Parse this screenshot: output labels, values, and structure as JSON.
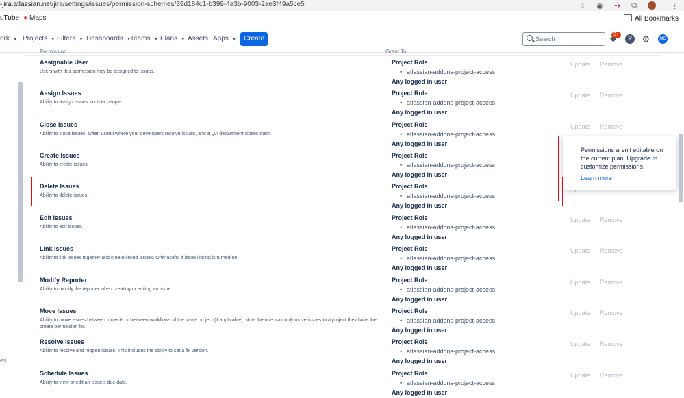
{
  "browser": {
    "url_host": "-jira.atlassian.net",
    "url_path": "/jira/settings/issues/permission-schemes/39d184c1-b399-4a3b-9003-2ae3f49a5ce5",
    "bookmarks": [
      {
        "label": "uTube"
      },
      {
        "label": "Maps"
      }
    ],
    "all_bookmarks": "All Bookmarks"
  },
  "nav": {
    "items": [
      "ork",
      "Projects",
      "Filters",
      "Dashboards",
      "Teams",
      "Plans",
      "Assets",
      "Apps"
    ],
    "create_label": "Create",
    "search_placeholder": "Search",
    "notifications_badge": "9+",
    "help_glyph": "?",
    "gear_glyph": "⚙",
    "avatar_initials": "MC"
  },
  "table": {
    "col_permission": "Permission",
    "col_grant": "Grant To",
    "action_update": "Update",
    "action_remove": "Remove",
    "rows": [
      {
        "name": "Assignable User",
        "desc": "Users with this permission may be assigned to issues.",
        "role": "Project Role",
        "item": "atlassian-addons-project-access",
        "any": "Any logged in user"
      },
      {
        "name": "Assign Issues",
        "desc": "Ability to assign issues to other people.",
        "role": "Project Role",
        "item": "atlassian-addons-project-access",
        "any": "Any logged in user"
      },
      {
        "name": "Close Issues",
        "desc": "Ability to close issues. Often useful where your developers resolve issues, and a QA department closes them.",
        "role": "Project Role",
        "item": "atlassian-addons-project-access",
        "any": "Any logged in user"
      },
      {
        "name": "Create Issues",
        "desc": "Ability to create issues.",
        "role": "Project Role",
        "item": "atlassian-addons-project-access",
        "any": "Any logged in user"
      },
      {
        "name": "Delete Issues",
        "desc": "Ability to delete issues.",
        "role": "Project Role",
        "item": "atlassian-addons-project-access",
        "any": "Any logged in user"
      },
      {
        "name": "Edit Issues",
        "desc": "Ability to edit issues.",
        "role": "Project Role",
        "item": "atlassian-addons-project-access",
        "any": "Any logged in user"
      },
      {
        "name": "Link Issues",
        "desc": "Ability to link issues together and create linked issues. Only useful if issue linking is turned on.",
        "role": "Project Role",
        "item": "atlassian-addons-project-access",
        "any": "Any logged in user"
      },
      {
        "name": "Modify Reporter",
        "desc": "Ability to modify the reporter when creating or editing an issue.",
        "role": "Project Role",
        "item": "atlassian-addons-project-access",
        "any": "Any logged in user"
      },
      {
        "name": "Move Issues",
        "desc": "Ability to move issues between projects or between workflows of the same project (if applicable). Note the user can only move issues to a project they have the create permission for.",
        "role": "Project Role",
        "item": "atlassian-addons-project-access",
        "any": "Any logged in user"
      },
      {
        "name": "Resolve Issues",
        "desc": "Ability to resolve and reopen issues. This includes the ability to set a fix version.",
        "role": "Project Role",
        "item": "atlassian-addons-project-access",
        "any": "Any logged in user"
      },
      {
        "name": "Schedule Issues",
        "desc": "Ability to view or edit an issue's due date.",
        "role": "Project Role",
        "item": "atlassian-addons-project-access",
        "any": "Any logged in user"
      }
    ]
  },
  "popup": {
    "text": "Permissions aren't editable on the current plan. Upgrade to customize permissions.",
    "link": "Learn more"
  },
  "sidebar_fragment": "es"
}
